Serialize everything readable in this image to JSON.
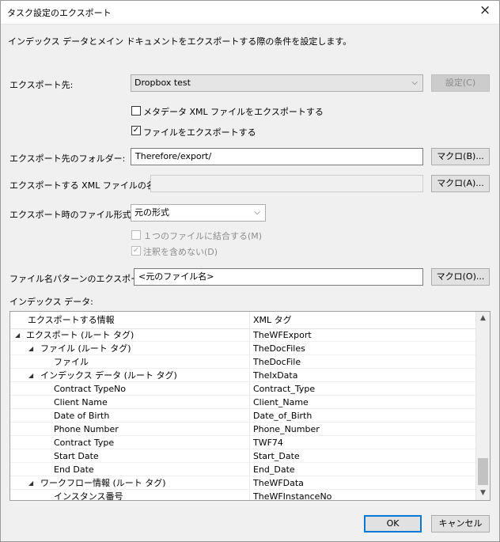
{
  "window": {
    "title": "タスク設定のエクスポート",
    "close_icon": "×",
    "description": "インデックス データとメイン ドキュメントをエクスポートする際の条件を設定します。"
  },
  "export_target": {
    "label": "エクスポート先:",
    "value": "Dropbox test",
    "settings_button": "設定(C)"
  },
  "checkboxes": {
    "metadata_xml": {
      "label": "メタデータ XML ファイルをエクスポートする",
      "checked": false
    },
    "export_files": {
      "label": "ファイルをエクスポートする",
      "checked": true
    }
  },
  "folder": {
    "label": "エクスポート先のフォルダー:",
    "value": "Therefore/export/",
    "macro_button": "マクロ(B)..."
  },
  "xml_name": {
    "label": "エクスポートする XML ファイルの名前:",
    "value": "",
    "macro_button": "マクロ(A)..."
  },
  "file_format": {
    "label": "エクスポート時のファイル形式:",
    "value": "元の形式",
    "merge_label": "１つのファイルに結合する(M)",
    "no_annotations_label": "注釈を含めない(D)"
  },
  "filename_pattern": {
    "label": "ファイル名パターンのエクスポート:",
    "value": "<元のファイル名>",
    "macro_button": "マクロ(O)..."
  },
  "index_data": {
    "label": "インデックス データ:",
    "columns": [
      "エクスポートする情報",
      "XML タグ"
    ],
    "rows": [
      {
        "name": "エクスポート (ルート タグ)",
        "tag": "TheWFExport"
      },
      {
        "name": "ファイル (ルート タグ)",
        "tag": "TheDocFiles"
      },
      {
        "name": "ファイル",
        "tag": "TheDocFile"
      },
      {
        "name": "インデックス データ (ルート タグ)",
        "tag": "TheIxData"
      },
      {
        "name": "Contract TypeNo",
        "tag": "Contract_Type"
      },
      {
        "name": "Client Name",
        "tag": "Client_Name"
      },
      {
        "name": "Date of Birth",
        "tag": "Date_of_Birth"
      },
      {
        "name": "Phone Number",
        "tag": "Phone_Number"
      },
      {
        "name": "Contract Type",
        "tag": "TWF74"
      },
      {
        "name": "Start Date",
        "tag": "Start_Date"
      },
      {
        "name": "End Date",
        "tag": "End_Date"
      },
      {
        "name": "ワークフロー情報 (ルート タグ)",
        "tag": "TheWFData"
      },
      {
        "name": "インスタンス番号",
        "tag": "TheWFInstanceNo"
      }
    ]
  },
  "footer": {
    "ok_button": "OK",
    "cancel_button": "キャンセル"
  },
  "colors": {
    "accent": "#0078d7",
    "window_bg": "#f0f0f0"
  }
}
